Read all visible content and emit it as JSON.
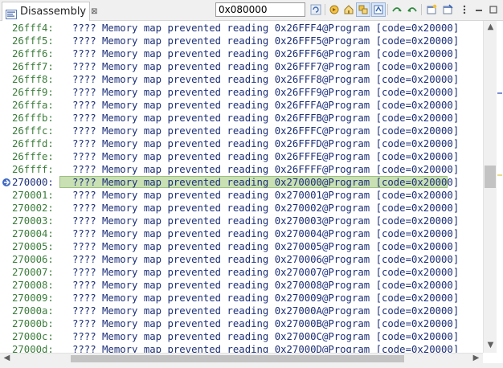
{
  "tab": {
    "label": "Disassembly",
    "close_glyph": "⊠"
  },
  "address_input": {
    "value": "0x080000"
  },
  "toolbar": {
    "buttons": [
      {
        "name": "refresh-icon"
      },
      {
        "name": "home-icon"
      },
      {
        "name": "link-with-pc-icon"
      },
      {
        "name": "sync-icon"
      },
      {
        "name": "step-over-icon"
      },
      {
        "name": "step-return-icon"
      },
      {
        "name": "new-view-icon"
      },
      {
        "name": "pin-icon"
      },
      {
        "name": "view-menu-icon"
      },
      {
        "name": "minimize-icon"
      },
      {
        "name": "maximize-icon"
      }
    ]
  },
  "lines": [
    {
      "addr": "26fff4:",
      "text": "???? Memory map prevented reading 0x26FFF4@Program [code=0x20000]"
    },
    {
      "addr": "26fff5:",
      "text": "???? Memory map prevented reading 0x26FFF5@Program [code=0x20000]"
    },
    {
      "addr": "26fff6:",
      "text": "???? Memory map prevented reading 0x26FFF6@Program [code=0x20000]"
    },
    {
      "addr": "26fff7:",
      "text": "???? Memory map prevented reading 0x26FFF7@Program [code=0x20000]"
    },
    {
      "addr": "26fff8:",
      "text": "???? Memory map prevented reading 0x26FFF8@Program [code=0x20000]"
    },
    {
      "addr": "26fff9:",
      "text": "???? Memory map prevented reading 0x26FFF9@Program [code=0x20000]"
    },
    {
      "addr": "26fffa:",
      "text": "???? Memory map prevented reading 0x26FFFA@Program [code=0x20000]"
    },
    {
      "addr": "26fffb:",
      "text": "???? Memory map prevented reading 0x26FFFB@Program [code=0x20000]"
    },
    {
      "addr": "26fffc:",
      "text": "???? Memory map prevented reading 0x26FFFC@Program [code=0x20000]"
    },
    {
      "addr": "26fffd:",
      "text": "???? Memory map prevented reading 0x26FFFD@Program [code=0x20000]"
    },
    {
      "addr": "26fffe:",
      "text": "???? Memory map prevented reading 0x26FFFE@Program [code=0x20000]"
    },
    {
      "addr": "26ffff:",
      "text": "???? Memory map prevented reading 0x26FFFF@Program [code=0x20000]"
    },
    {
      "addr": "270000:",
      "text": "???? Memory map prevented reading 0x270000@Program [code=0x20000]",
      "current": true
    },
    {
      "addr": "270001:",
      "text": "???? Memory map prevented reading 0x270001@Program [code=0x20000]"
    },
    {
      "addr": "270002:",
      "text": "???? Memory map prevented reading 0x270002@Program [code=0x20000]"
    },
    {
      "addr": "270003:",
      "text": "???? Memory map prevented reading 0x270003@Program [code=0x20000]"
    },
    {
      "addr": "270004:",
      "text": "???? Memory map prevented reading 0x270004@Program [code=0x20000]"
    },
    {
      "addr": "270005:",
      "text": "???? Memory map prevented reading 0x270005@Program [code=0x20000]"
    },
    {
      "addr": "270006:",
      "text": "???? Memory map prevented reading 0x270006@Program [code=0x20000]"
    },
    {
      "addr": "270007:",
      "text": "???? Memory map prevented reading 0x270007@Program [code=0x20000]"
    },
    {
      "addr": "270008:",
      "text": "???? Memory map prevented reading 0x270008@Program [code=0x20000]"
    },
    {
      "addr": "270009:",
      "text": "???? Memory map prevented reading 0x270009@Program [code=0x20000]"
    },
    {
      "addr": "27000a:",
      "text": "???? Memory map prevented reading 0x27000A@Program [code=0x20000]"
    },
    {
      "addr": "27000b:",
      "text": "???? Memory map prevented reading 0x27000B@Program [code=0x20000]"
    },
    {
      "addr": "27000c:",
      "text": "???? Memory map prevented reading 0x27000C@Program [code=0x20000]"
    },
    {
      "addr": "27000d:",
      "text": "???? Memory map prevented reading 0x27000D@Program [code=0x20000]"
    }
  ],
  "colors": {
    "address": "#3b7d3b",
    "instruction": "#1c2f78",
    "current_line_bg": "#c9e0b5"
  }
}
